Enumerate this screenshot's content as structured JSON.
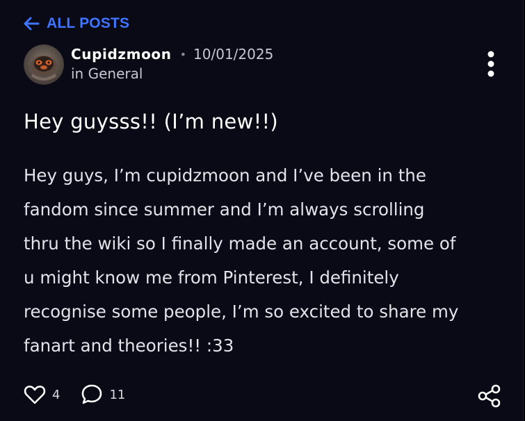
{
  "nav": {
    "back_label": "ALL POSTS"
  },
  "post": {
    "author": "Cupidzmoon",
    "separator": "•",
    "date": "10/01/2025",
    "category": "in General",
    "title": "Hey guysss!! (I’m new!!)",
    "body_lines": [
      "Hey guys, I’m cupidzmoon and I’ve been in the",
      "fandom since summer and I’m always scrolling",
      "thru the wiki so I finally made an account, some of",
      "u might know me from Pinterest, I definitely",
      "recognise some people, I’m so excited to share my",
      "fanart and theories!! :33"
    ],
    "likes": "4",
    "comments": "11"
  },
  "colors": {
    "background": "#0a0916",
    "accent": "#3f74ff",
    "text": "#ffffff",
    "muted": "#c8c7cf"
  },
  "icons": {
    "back": "arrow-left-icon",
    "more": "more-vertical-icon",
    "like": "heart-icon",
    "comment": "comment-icon",
    "share": "share-icon"
  }
}
